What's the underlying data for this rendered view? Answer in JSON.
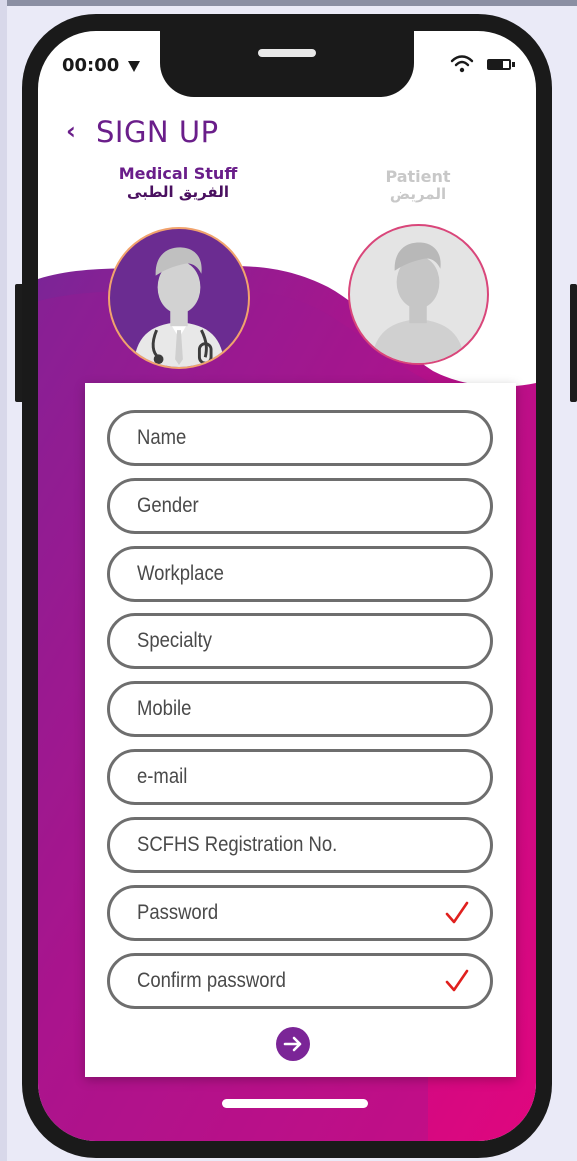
{
  "status_bar": {
    "time": "00:00",
    "signal_icon": "triangle-signal-icon",
    "wifi_icon": "wifi-icon",
    "battery_icon": "battery-icon"
  },
  "header": {
    "back_icon": "chevron-left-icon",
    "back_glyph": "‹",
    "title": "SIGN UP"
  },
  "roles": {
    "medical": {
      "label_en": "Medical Stuff",
      "label_ar": "الفريق الطبى",
      "selected": true
    },
    "patient": {
      "label_en": "Patient",
      "label_ar": "المريض",
      "selected": false
    }
  },
  "form": {
    "fields": [
      {
        "placeholder": "Name",
        "value": ""
      },
      {
        "placeholder": "Gender",
        "value": ""
      },
      {
        "placeholder": "Workplace",
        "value": ""
      },
      {
        "placeholder": "Specialty",
        "value": ""
      },
      {
        "placeholder": "Mobile",
        "value": ""
      },
      {
        "placeholder": "e-mail",
        "value": ""
      },
      {
        "placeholder": "SCFHS Registration No.",
        "value": ""
      },
      {
        "placeholder": "Password",
        "value": "",
        "validated": true
      },
      {
        "placeholder": "Confirm password",
        "value": "",
        "validated": true
      }
    ],
    "submit_icon": "arrow-right-icon"
  },
  "colors": {
    "brand_purple": "#6a1e8a",
    "gradient_start": "#7b2597",
    "gradient_end": "#e0067e",
    "check_red": "#e0201e",
    "field_border": "#6e6e6e"
  }
}
